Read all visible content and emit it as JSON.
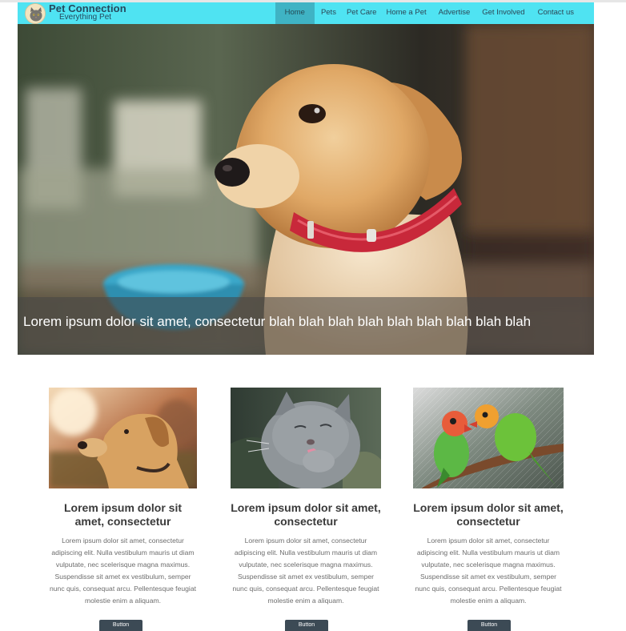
{
  "header": {
    "brand_title": "Pet Connection",
    "brand_subtitle": "Everything Pet",
    "logo_icon": "cat-face-icon",
    "accent_color": "#4fe3f2",
    "active_color": "#3fb3c4",
    "nav": [
      {
        "label": "Home",
        "active": true
      },
      {
        "label": "Pets",
        "active": false
      },
      {
        "label": "Pet Care",
        "active": false
      },
      {
        "label": "Home a Pet",
        "active": false
      },
      {
        "label": "Advertise",
        "active": false
      },
      {
        "label": "Get Involved",
        "active": false
      },
      {
        "label": "Contact us",
        "active": false
      }
    ]
  },
  "hero": {
    "image": "puppy-photo",
    "caption": "Lorem ipsum dolor sit amet, consectetur blah blah blah blah blah blah blah blah blah"
  },
  "cards": [
    {
      "image": "dog-photo",
      "title": "Lorem ipsum dolor sit amet, consectetur",
      "text": "Lorem ipsum dolor sit amet, consectetur adipiscing elit. Nulla vestibulum mauris ut diam vulputate, nec scelerisque magna maximus. Suspendisse sit amet ex vestibulum, semper nunc quis, consequat arcu. Pellentesque feugiat molestie enim a aliquam.",
      "button": "Button"
    },
    {
      "image": "cat-photo",
      "title": "Lorem ipsum dolor sit amet, consectetur",
      "text": "Lorem ipsum dolor sit amet, consectetur adipiscing elit. Nulla vestibulum mauris ut diam vulputate, nec scelerisque magna maximus. Suspendisse sit amet ex vestibulum, semper nunc quis, consequat arcu. Pellentesque feugiat molestie enim a aliquam.",
      "button": "Button"
    },
    {
      "image": "parrots-photo",
      "title": "Lorem ipsum dolor sit amet, consectetur",
      "text": "Lorem ipsum dolor sit amet, consectetur adipiscing elit. Nulla vestibulum mauris ut diam vulputate, nec scelerisque magna maximus. Suspendisse sit amet ex vestibulum, semper nunc quis, consequat arcu. Pellentesque feugiat molestie enim a aliquam.",
      "button": "Button"
    }
  ]
}
